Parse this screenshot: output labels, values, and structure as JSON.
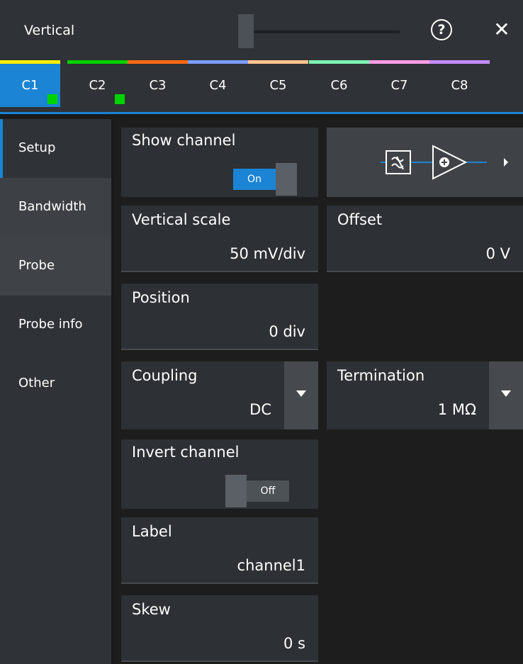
{
  "header": {
    "title": "Vertical",
    "help_icon": "?",
    "close_icon": "✕"
  },
  "colors": {
    "accent": "#1b84d4",
    "indicator": "#00d400",
    "panel_bg": "#2f3236"
  },
  "tabs": [
    {
      "label": "C1",
      "color": "#ffef00",
      "active": true,
      "indicator": true
    },
    {
      "label": "C2",
      "color": "#00d400",
      "active": false,
      "indicator": true
    },
    {
      "label": "C3",
      "color": "#ff6a13",
      "active": false,
      "indicator": false
    },
    {
      "label": "C4",
      "color": "#7b9cff",
      "active": false,
      "indicator": false
    },
    {
      "label": "C5",
      "color": "#ffc58f",
      "active": false,
      "indicator": false
    },
    {
      "label": "C6",
      "color": "#7ef0b0",
      "active": false,
      "indicator": false
    },
    {
      "label": "C7",
      "color": "#ff9ee6",
      "active": false,
      "indicator": false
    },
    {
      "label": "C8",
      "color": "#c68cff",
      "active": false,
      "indicator": false
    }
  ],
  "sidebar": {
    "items": [
      {
        "label": "Setup"
      },
      {
        "label": "Bandwidth"
      },
      {
        "label": "Probe"
      },
      {
        "label": "Probe info"
      },
      {
        "label": "Other"
      }
    ]
  },
  "settings": {
    "show_channel": {
      "label": "Show channel",
      "state": "On"
    },
    "vertical_scale": {
      "label": "Vertical scale",
      "value": "50 mV/div"
    },
    "offset": {
      "label": "Offset",
      "value": "0 V"
    },
    "position": {
      "label": "Position",
      "value": "0 div"
    },
    "coupling": {
      "label": "Coupling",
      "value": "DC"
    },
    "termination": {
      "label": "Termination",
      "value": "1 MΩ"
    },
    "invert_channel": {
      "label": "Invert channel",
      "state": "Off"
    },
    "label": {
      "label": "Label",
      "value": "channel1"
    },
    "skew": {
      "label": "Skew",
      "value": "0 s"
    }
  }
}
